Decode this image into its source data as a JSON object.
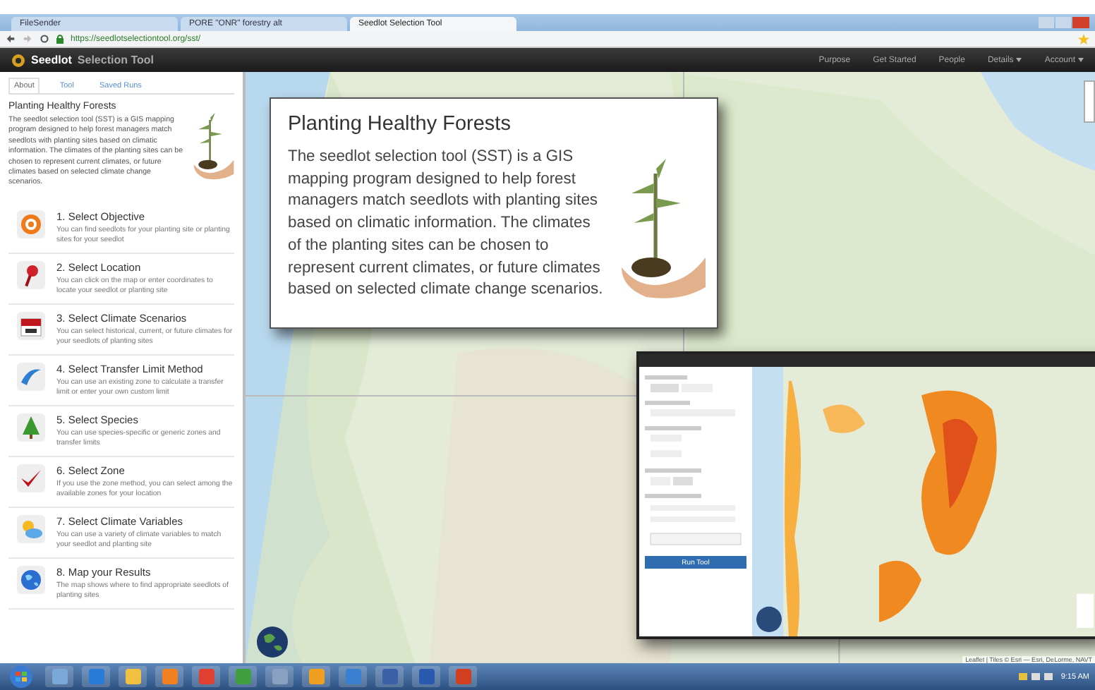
{
  "browser": {
    "tabs": [
      {
        "label": "FileSender",
        "selected": false
      },
      {
        "label": "PORE \"ONR\" forestry alt",
        "selected": false
      },
      {
        "label": "Seedlot Selection Tool",
        "selected": true
      }
    ],
    "url": "https://seedlotselectiontool.org/sst/"
  },
  "app": {
    "logo_bold": "Seedlot",
    "logo_rest": "Selection Tool",
    "nav": [
      {
        "label": "Purpose",
        "dropdown": false
      },
      {
        "label": "Get Started",
        "dropdown": false
      },
      {
        "label": "People",
        "dropdown": false
      },
      {
        "label": "Details",
        "dropdown": true
      },
      {
        "label": "Account",
        "dropdown": true
      }
    ]
  },
  "sidebar": {
    "tabs": [
      {
        "label": "About",
        "selected": true
      },
      {
        "label": "Tool",
        "selected": false
      },
      {
        "label": "Saved Runs",
        "selected": false
      }
    ],
    "intro": {
      "title": "Planting Healthy Forests",
      "text": "The seedlot selection tool (SST) is a GIS mapping program designed to help forest managers match seedlots with planting sites based on climatic information. The climates of the planting sites can be chosen to represent current climates, or future climates based on selected climate change scenarios."
    },
    "steps": [
      {
        "kind": "target",
        "title": "1. Select Objective",
        "description": "You can find seedlots for your planting site or planting sites for your seedlot"
      },
      {
        "kind": "pin",
        "title": "2. Select Location",
        "description": "You can click on the map or enter coordinates to locate your seedlot or planting site"
      },
      {
        "kind": "calendar",
        "title": "3. Select Climate Scenarios",
        "description": "You can select historical, current, or future climates for your seedlots of planting sites"
      },
      {
        "kind": "boomerang",
        "title": "4. Select Transfer Limit Method",
        "description": "You can use an existing zone to calculate a transfer limit or enter your own custom limit"
      },
      {
        "kind": "tree",
        "title": "5. Select Species",
        "description": "You can use species-specific or generic zones and transfer limits"
      },
      {
        "kind": "check",
        "title": "6. Select Zone",
        "description": "If you use the zone method, you can select among the available zones for your location"
      },
      {
        "kind": "weather",
        "title": "7. Select Climate Variables",
        "description": "You can use a variety of climate variables to match your seedlot and planting site"
      },
      {
        "kind": "globe",
        "title": "8. Map your Results",
        "description": "The map shows where to find appropriate seedlots of planting sites"
      }
    ]
  },
  "popup": {
    "title": "Planting Healthy Forests",
    "text": "The seedlot selection tool (SST) is a GIS mapping program designed to help forest managers match seedlots with planting sites based on climatic information. The climates of the planting sites can be chosen to represent current climates, or future climates based on selected climate change scenarios."
  },
  "inset": {
    "button": "Run Tool"
  },
  "map": {
    "attribution": "Leaflet | Tiles © Esri — Esri, DeLorme, NAVT"
  },
  "taskbar": {
    "clock": "9:15 AM"
  }
}
